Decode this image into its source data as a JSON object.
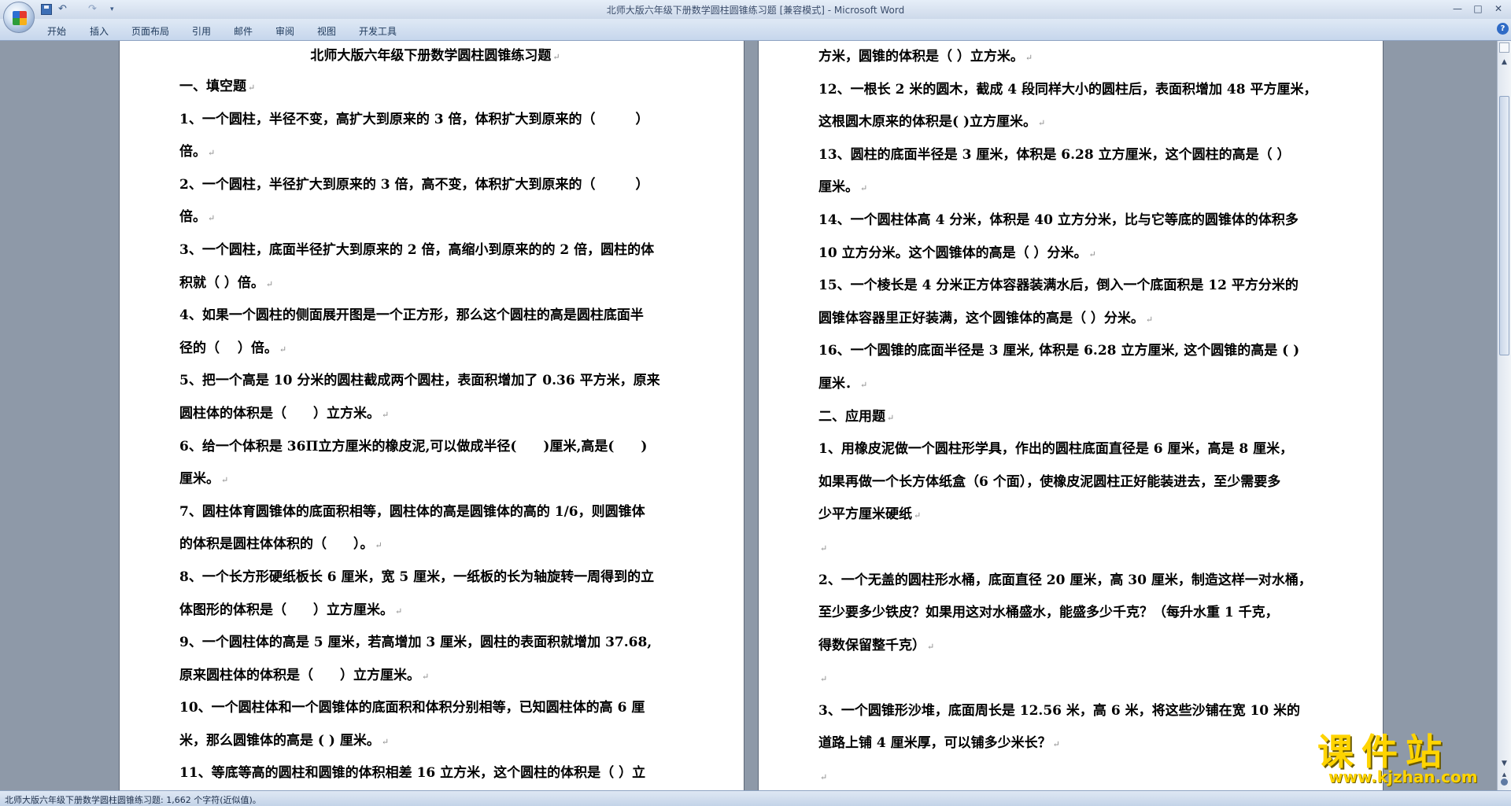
{
  "window": {
    "title": "北师大版六年级下册数学圆柱圆锥练习题 [兼容模式] - Microsoft Word"
  },
  "quick_access": {
    "undo": "↶",
    "redo": "↷",
    "more": "▾"
  },
  "window_controls": {
    "minimize": "—",
    "maximize": "□",
    "close": "✕"
  },
  "ribbon_tabs": [
    {
      "label": "开始"
    },
    {
      "label": "插入"
    },
    {
      "label": "页面布局"
    },
    {
      "label": "引用"
    },
    {
      "label": "邮件"
    },
    {
      "label": "审阅"
    },
    {
      "label": "视图"
    },
    {
      "label": "开发工具"
    }
  ],
  "help_icon": "?",
  "document": {
    "title": "北师大版六年级下册数学圆柱圆锥练习题",
    "left_lines": [
      "一、填空题",
      "1、一个圆柱，半径不变，高扩大到原来的 3 倍，体积扩大到原来的（　　　）",
      "倍。",
      "2、一个圆柱，半径扩大到原来的 3 倍，高不变，体积扩大到原来的（　　　）",
      "倍。",
      "3、一个圆柱，底面半径扩大到原来的 2 倍，高缩小到原来的的 2 倍，圆柱的体",
      "积就（ ）倍。",
      "4、如果一个圆柱的侧面展开图是一个正方形，那么这个圆柱的高是圆柱底面半",
      "径的（　 ）倍。",
      "5、把一个高是 10 分米的圆柱截成两个圆柱，表面积增加了 0.36 平方米，原来",
      "圆柱体的体积是（　　）立方米。",
      "6、给一个体积是 36Π立方厘米的橡皮泥,可以做成半径(　　)厘米,高是(　　)",
      "厘米。",
      "7、圆柱体育圆锥体的底面积相等，圆柱体的高是圆锥体的高的 1/6，则圆锥体",
      "的体积是圆柱体体积的（　　）。",
      "8、一个长方形硬纸板长 6 厘米，宽 5 厘米，一纸板的长为轴旋转一周得到的立",
      "体图形的体积是（　　）立方厘米。",
      "9、一个圆柱体的高是 5 厘米，若高增加 3 厘米，圆柱的表面积就增加 37.68,",
      "原来圆柱体的体积是（　　）立方厘米。",
      "10、一个圆柱体和一个圆锥体的底面积和体积分别相等，已知圆柱体的高 6 厘",
      "米，那么圆锥体的高是 ( ) 厘米。",
      "11、等底等高的圆柱和圆锥的体积相差 16 立方米，这个圆柱的体积是（ ）立"
    ],
    "right_lines": [
      "方米，圆锥的体积是（ ）立方米。",
      "12、一根长 2 米的圆木，截成 4 段同样大小的圆柱后，表面积增加 48 平方厘米，",
      "这根圆木原来的体积是( )立方厘米。",
      "13、圆柱的底面半径是 3 厘米，体积是 6.28 立方厘米，这个圆柱的高是（ ）",
      "厘米。",
      "14、一个圆柱体高 4 分米，体积是 40 立方分米，比与它等底的圆锥体的体积多",
      "10 立方分米。这个圆锥体的高是（ ）分米。",
      "15、一个棱长是 4 分米正方体容器装满水后，倒入一个底面积是 12 平方分米的",
      "圆锥体容器里正好装满，这个圆锥体的高是（ ）分米。",
      "16、一个圆锥的底面半径是 3 厘米, 体积是 6.28 立方厘米, 这个圆锥的高是 ( )",
      "厘米．",
      "二、应用题",
      "1、用橡皮泥做一个圆柱形学具，作出的圆柱底面直径是 6 厘米，高是 8 厘米，",
      "如果再做一个长方体纸盒（6 个面），使橡皮泥圆柱正好能装进去，至少需要多",
      "少平方厘米硬纸",
      "",
      "2、一个无盖的圆柱形水桶，底面直径 20 厘米，高 30 厘米，制造这样一对水桶，",
      "至少要多少铁皮？如果用这对水桶盛水，能盛多少千克？（每升水重 1 千克，",
      "得数保留整千克）",
      "",
      "3、一个圆锥形沙堆，底面周长是 12.56 米，高 6 米，将这些沙铺在宽 10 米的",
      "道路上铺 4 厘米厚，可以铺多少米长？",
      ""
    ]
  },
  "paragraph_mark": "↵",
  "scrollbar": {
    "up": "▲",
    "down": "▼",
    "browse_prev": "▲"
  },
  "status_bar": {
    "text": "北师大版六年级下册数学圆柱圆锥练习题: 1,662 个字符(近似值)。"
  },
  "watermark": {
    "main": "课件站",
    "url": "www.kjzhan.com"
  }
}
